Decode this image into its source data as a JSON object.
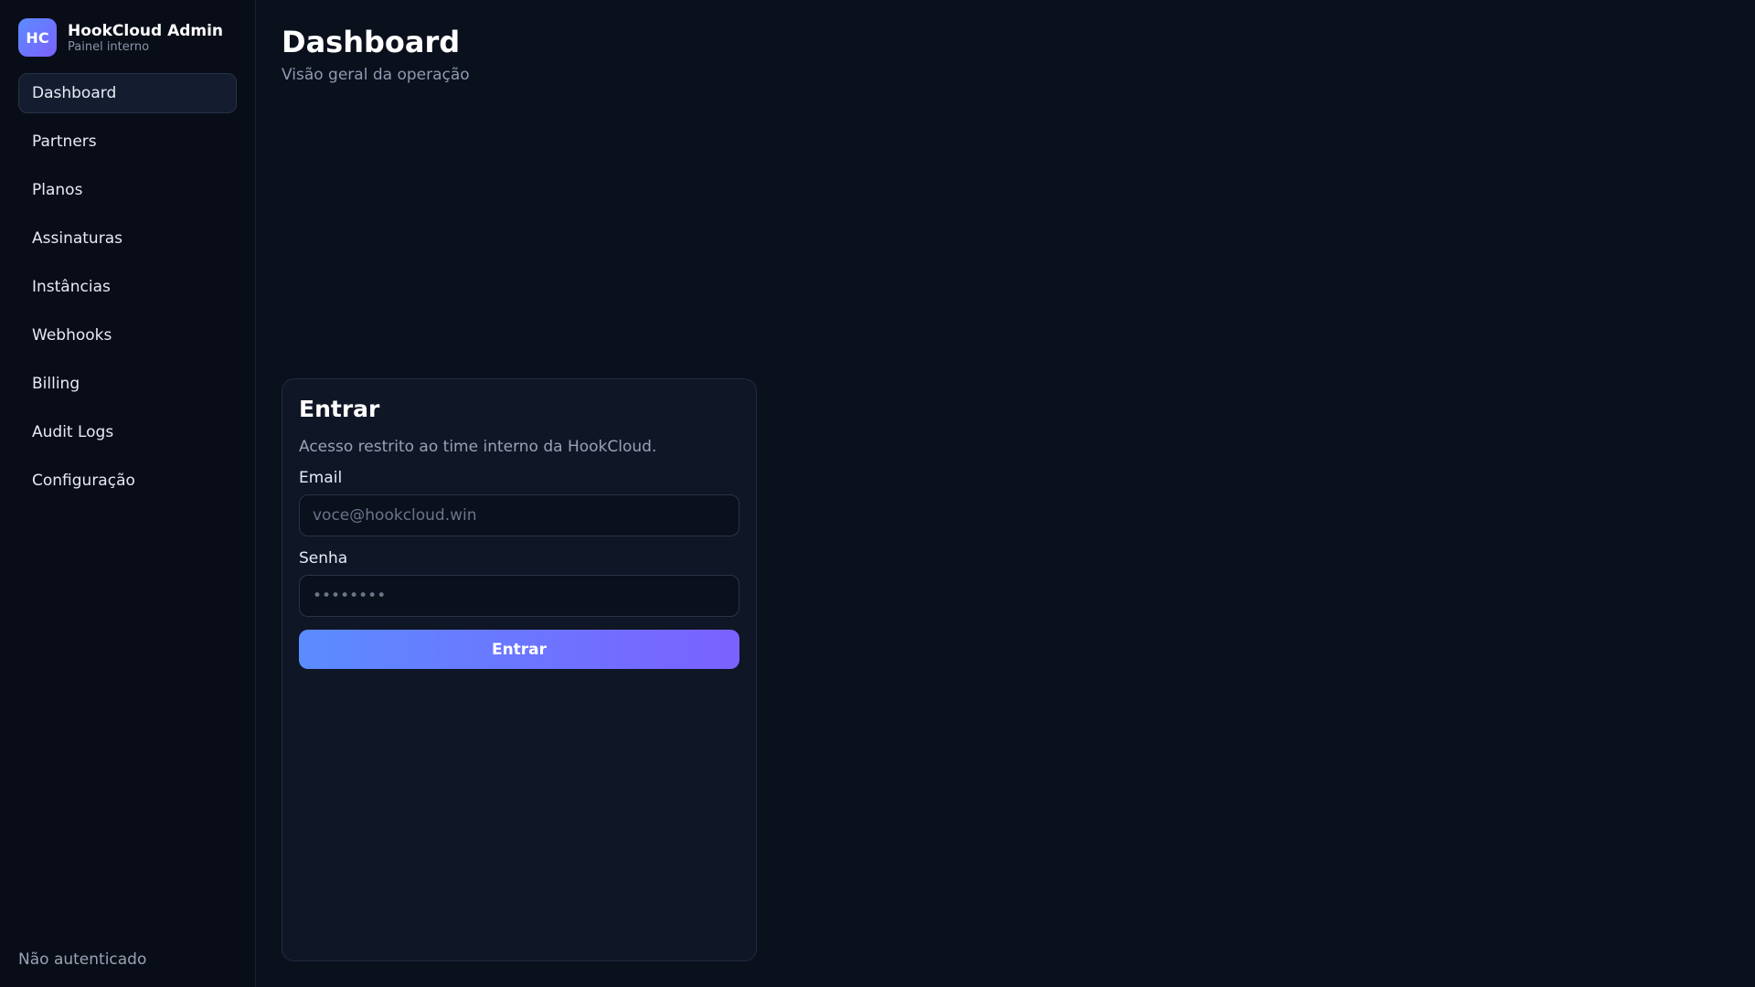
{
  "sidebar": {
    "logo_text": "HC",
    "brand_name": "HookCloud Admin",
    "brand_sub": "Painel interno",
    "items": [
      {
        "label": "Dashboard",
        "active": true
      },
      {
        "label": "Partners"
      },
      {
        "label": "Planos"
      },
      {
        "label": "Assinaturas"
      },
      {
        "label": "Instâncias"
      },
      {
        "label": "Webhooks"
      },
      {
        "label": "Billing"
      },
      {
        "label": "Audit Logs"
      },
      {
        "label": "Configuração"
      }
    ],
    "footer_status": "Não autenticado"
  },
  "header": {
    "title": "Dashboard",
    "subtitle": "Visão geral da operação"
  },
  "login": {
    "title": "Entrar",
    "description": "Acesso restrito ao time interno da HookCloud.",
    "email_label": "Email",
    "email_placeholder": "voce@hookcloud.win",
    "email_value": "",
    "password_label": "Senha",
    "password_placeholder": "••••••••",
    "password_value": "",
    "submit_label": "Entrar"
  },
  "colors": {
    "background": "#0a101c",
    "sidebar": "#080d17",
    "card": "#0f1626",
    "accent_start": "#5b8cff",
    "accent_end": "#7b61ff"
  }
}
